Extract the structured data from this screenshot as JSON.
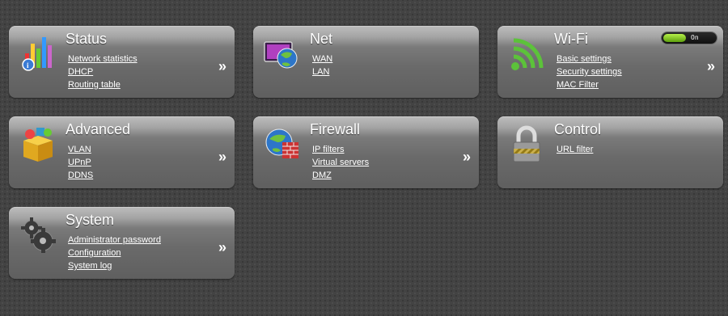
{
  "cards": {
    "status": {
      "title": "Status",
      "links": [
        "Network statistics",
        "DHCP",
        "Routing table"
      ],
      "more": "»",
      "icon": "status-chart-icon"
    },
    "net": {
      "title": "Net",
      "links": [
        "WAN",
        "LAN"
      ],
      "icon": "net-globe-monitor-icon"
    },
    "wifi": {
      "title": "Wi-Fi",
      "links": [
        "Basic settings",
        "Security settings",
        "MAC Filter"
      ],
      "more": "»",
      "toggle_label": "On",
      "toggle_state": "on",
      "icon": "wifi-signal-icon"
    },
    "advanced": {
      "title": "Advanced",
      "links": [
        "VLAN",
        "UPnP",
        "DDNS"
      ],
      "more": "»",
      "icon": "advanced-box-icon"
    },
    "firewall": {
      "title": "Firewall",
      "links": [
        "IP filters",
        "Virtual servers",
        "DMZ"
      ],
      "more": "»",
      "icon": "firewall-globe-icon"
    },
    "control": {
      "title": "Control",
      "links": [
        "URL filter"
      ],
      "icon": "padlock-icon"
    },
    "system": {
      "title": "System",
      "links": [
        "Administrator password",
        "Configuration",
        "System log"
      ],
      "more": "»",
      "icon": "gears-icon"
    }
  }
}
